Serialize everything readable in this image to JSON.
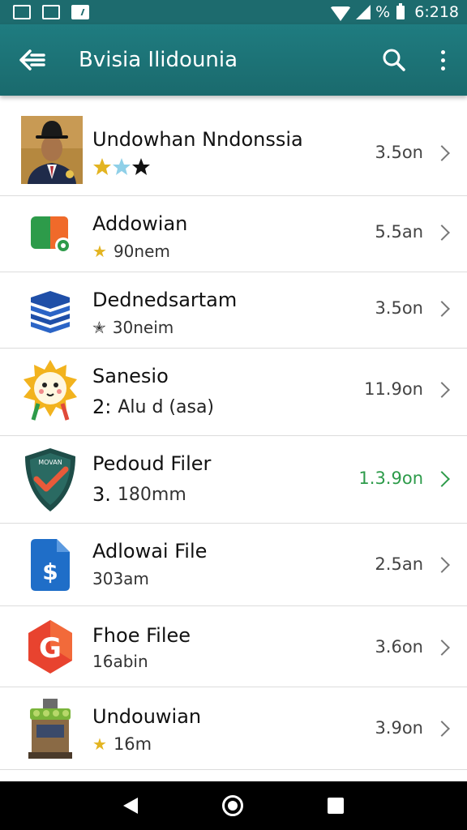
{
  "status_bar": {
    "battery_text": "%",
    "time": "6:218"
  },
  "app_bar": {
    "title": "Bvisia Ilidounia",
    "back_icon": "arrow-back-icon",
    "search_icon": "search-icon",
    "more_icon": "more-vert-icon"
  },
  "items": [
    {
      "title": "Undowhan Nndonssia",
      "subtitle": "",
      "size": "3.5on",
      "icon": "avatar-man-hat",
      "stars": "★★★",
      "prefix": ""
    },
    {
      "title": "Addowian",
      "subtitle": "90nem",
      "size": "5.5an",
      "icon": "app-icon-orange-green",
      "stars": "★",
      "prefix": ""
    },
    {
      "title": "Dednedsartam",
      "subtitle": "30neim",
      "size": "3.5on",
      "icon": "stack-layers-icon",
      "stars": "★",
      "prefix": ""
    },
    {
      "title": "Sanesio",
      "subtitle": "Alu d (asa)",
      "size": "11.9on",
      "icon": "sun-face-icon",
      "stars": "",
      "prefix": "2:"
    },
    {
      "title": "Pedoud Filer",
      "subtitle": "180mm",
      "size": "1.3.9on",
      "icon": "shield-check-icon",
      "stars": "",
      "prefix": "3."
    },
    {
      "title": "Adlowai File",
      "subtitle": "303am",
      "size": "2.5an",
      "icon": "file-dollar-icon",
      "stars": "",
      "prefix": ""
    },
    {
      "title": "Fhoe Filee",
      "subtitle": "16abin",
      "size": "3.6on",
      "icon": "hexagon-g-icon",
      "stars": "",
      "prefix": ""
    },
    {
      "title": "Undouwian",
      "subtitle": "16m",
      "size": "3.9on",
      "icon": "kiosk-stand-icon",
      "stars": "★",
      "prefix": ""
    }
  ],
  "shield_text": "MOVAN",
  "g_letter": "G",
  "dollar_letter": "$",
  "colors": {
    "app_bar": "#1d6b6e",
    "accent_green": "#2d9b4a",
    "star_gold": "#e3b421"
  }
}
